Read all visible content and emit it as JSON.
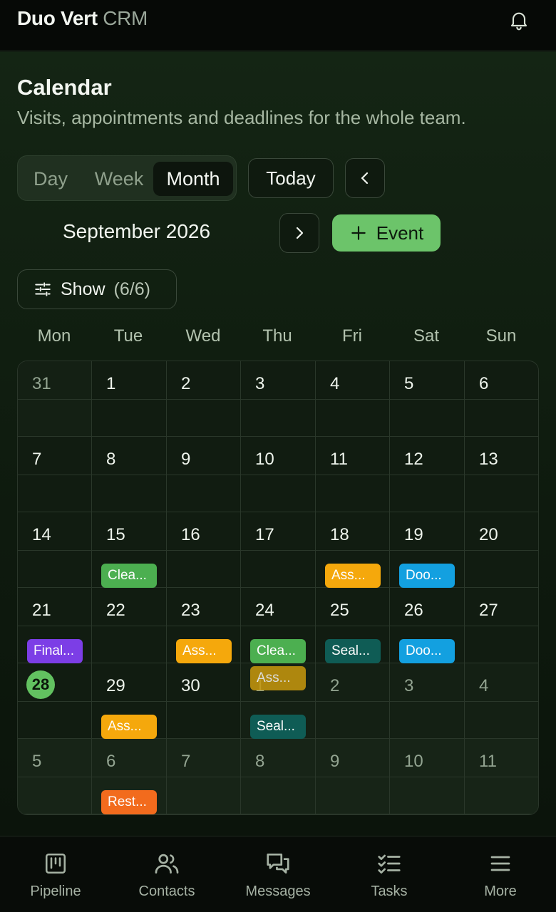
{
  "header": {
    "brand_main": "Duo Vert",
    "brand_sub": "CRM"
  },
  "page": {
    "title": "Calendar",
    "subtitle": "Visits, appointments and deadlines for the whole team."
  },
  "view_switch": {
    "day": "Day",
    "week": "Week",
    "month": "Month",
    "active": "Month"
  },
  "toolbar": {
    "today": "Today",
    "month_label": "September 2026",
    "add_event": "Event",
    "show_label": "Show",
    "show_count": "(6/6)"
  },
  "weekdays": [
    "Mon",
    "Tue",
    "Wed",
    "Thu",
    "Fri",
    "Sat",
    "Sun"
  ],
  "calendar": {
    "today": "28",
    "weeks": [
      [
        "31",
        "1",
        "2",
        "3",
        "4",
        "5",
        "6"
      ],
      [
        "7",
        "8",
        "9",
        "10",
        "11",
        "12",
        "13"
      ],
      [
        "14",
        "15",
        "16",
        "17",
        "18",
        "19",
        "20"
      ],
      [
        "21",
        "22",
        "23",
        "24",
        "25",
        "26",
        "27"
      ],
      [
        "28",
        "29",
        "30",
        "1",
        "2",
        "3",
        "4"
      ],
      [
        "5",
        "6",
        "7",
        "8",
        "9",
        "10",
        "11"
      ]
    ],
    "events": [
      {
        "week": 2,
        "day": 1,
        "slot": 0,
        "label": "Clea...",
        "color": "#4caf50"
      },
      {
        "week": 2,
        "day": 4,
        "slot": 0,
        "label": "Ass...",
        "color": "#f5a80c"
      },
      {
        "week": 2,
        "day": 5,
        "slot": 0,
        "label": "Doo...",
        "color": "#13a0e0"
      },
      {
        "week": 3,
        "day": 0,
        "slot": 0,
        "label": "Final...",
        "color": "#7c3ee6"
      },
      {
        "week": 3,
        "day": 2,
        "slot": 0,
        "label": "Ass...",
        "color": "#f5a80c"
      },
      {
        "week": 3,
        "day": 3,
        "slot": 0,
        "label": "Clea...",
        "color": "#4caf50"
      },
      {
        "week": 3,
        "day": 3,
        "slot": 1,
        "label": "Ass...",
        "color": "#c99a0e"
      },
      {
        "week": 3,
        "day": 4,
        "slot": 0,
        "label": "Seal...",
        "color": "#0f5c55"
      },
      {
        "week": 3,
        "day": 5,
        "slot": 0,
        "label": "Doo...",
        "color": "#13a0e0"
      },
      {
        "week": 4,
        "day": 1,
        "slot": 0,
        "label": "Ass...",
        "color": "#f5a80c"
      },
      {
        "week": 4,
        "day": 3,
        "slot": 0,
        "label": "Seal...",
        "color": "#0f5c55"
      },
      {
        "week": 5,
        "day": 1,
        "slot": 0,
        "label": "Rest...",
        "color": "#f26b1d"
      }
    ]
  },
  "bottom_nav": {
    "pipeline": "Pipeline",
    "contacts": "Contacts",
    "messages": "Messages",
    "tasks": "Tasks",
    "more": "More"
  }
}
